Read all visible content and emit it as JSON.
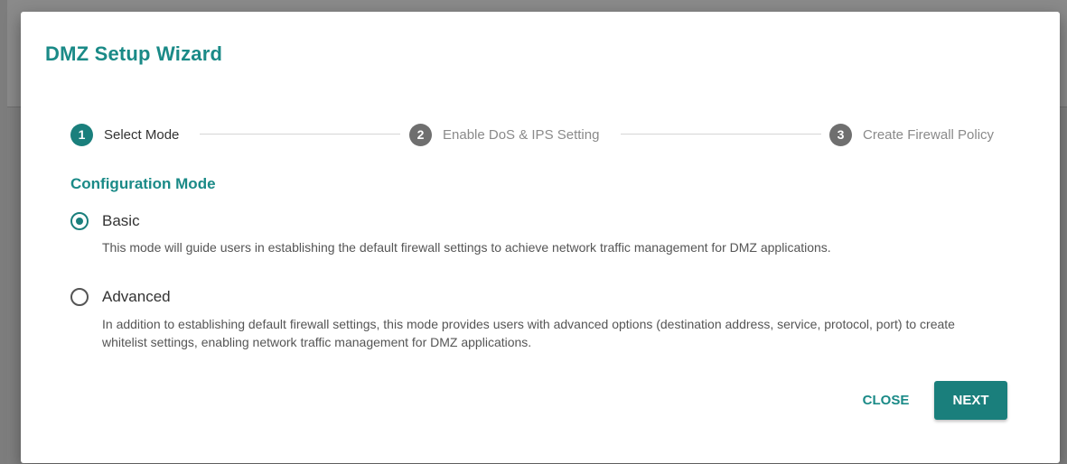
{
  "dialog": {
    "title": "DMZ Setup Wizard"
  },
  "stepper": {
    "steps": [
      {
        "number": "1",
        "label": "Select Mode",
        "state": "active"
      },
      {
        "number": "2",
        "label": "Enable DoS & IPS Setting",
        "state": "inactive"
      },
      {
        "number": "3",
        "label": "Create Firewall Policy",
        "state": "inactive"
      }
    ]
  },
  "config": {
    "heading": "Configuration Mode",
    "options": [
      {
        "label": "Basic",
        "selected": true,
        "description": "This mode will guide users in establishing the default firewall settings to achieve network traffic management for DMZ applications."
      },
      {
        "label": "Advanced",
        "selected": false,
        "description": "In addition to establishing default firewall settings, this mode provides users with advanced options (destination address, service, protocol, port) to create whitelist settings, enabling network traffic management for DMZ applications."
      }
    ]
  },
  "actions": {
    "close_label": "CLOSE",
    "next_label": "NEXT"
  },
  "colors": {
    "accent": "#1a8a87",
    "primary_button": "#1a7f7c",
    "inactive_step": "#6f6f6f"
  }
}
